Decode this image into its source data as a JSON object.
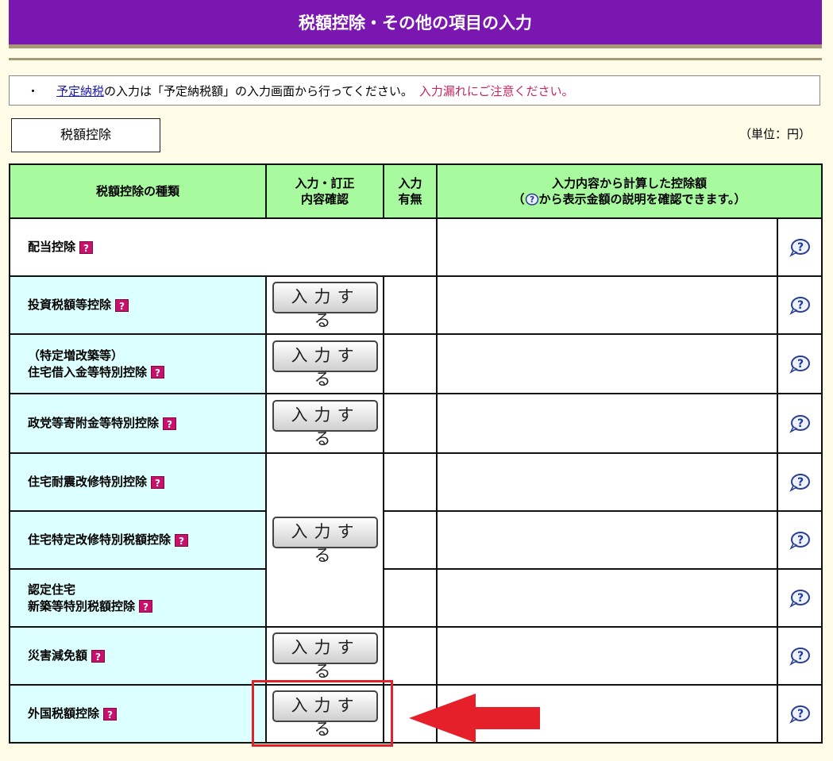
{
  "header": {
    "title": "税額控除・その他の項目の入力"
  },
  "notice": {
    "bullet": "・",
    "link": "予定納税",
    "text": "の入力は「予定納税額」の入力画面から行ってください。",
    "warning": "入力漏れにご注意ください。"
  },
  "section": {
    "tab_label": "税額控除",
    "unit": "（単位：円）"
  },
  "table": {
    "col1": "税額控除の種類",
    "col2a": "入力・訂正",
    "col2b": "内容確認",
    "col3a": "入力",
    "col3b": "有無",
    "col4a": "入力内容から計算した控除額",
    "col4b_pre": "（",
    "col4b_post": "から表示金額の説明を確認できます。）",
    "button_label": "入力する",
    "help_glyph": "?",
    "rows": [
      {
        "name1": "配当控除",
        "name2": ""
      },
      {
        "name1": "投資税額等控除",
        "name2": ""
      },
      {
        "name1": "（特定増改築等）",
        "name2": "住宅借入金等特別控除"
      },
      {
        "name1": "政党等寄附金等特別控除",
        "name2": ""
      },
      {
        "name1": "住宅耐震改修特別控除",
        "name2": ""
      },
      {
        "name1": "住宅特定改修特別税額控除",
        "name2": ""
      },
      {
        "name1": "認定住宅",
        "name2": "新築等特別税額控除"
      },
      {
        "name1": "災害減免額",
        "name2": ""
      },
      {
        "name1": "外国税額控除",
        "name2": ""
      }
    ]
  },
  "icons": {
    "help_small": "question-icon",
    "help_bubble": "help-bubble-icon"
  },
  "colors": {
    "header": "#7a17b0",
    "table_header": "#a7fa9d",
    "row_bg": "#dcffff",
    "highlight": "#e0232b"
  }
}
